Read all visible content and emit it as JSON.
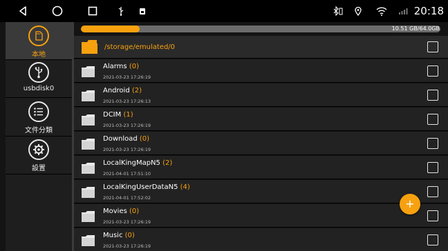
{
  "status_bar": {
    "time": "20:18",
    "icons": [
      "back-icon",
      "home-icon",
      "recents-icon",
      "usb-icon",
      "screenshot-icon",
      "bluetooth-icon",
      "location-icon",
      "wifi-icon",
      "cellular-signal-icon"
    ]
  },
  "sidebar": {
    "items": [
      {
        "label": "本地",
        "icon": "sd-card-icon",
        "active": true
      },
      {
        "label": "usbdisk0",
        "icon": "usb-icon",
        "active": false
      },
      {
        "label": "文件分類",
        "icon": "list-icon",
        "active": false
      },
      {
        "label": "設置",
        "icon": "gear-icon",
        "active": false
      }
    ]
  },
  "storage": {
    "text": "10.51 GB/64.0GB",
    "used_fraction": 0.164
  },
  "path": {
    "text": "/storage/emulated/0"
  },
  "files": [
    {
      "name": "Alarms",
      "count": "(0)",
      "date": "2021-03-23 17:26:19"
    },
    {
      "name": "Android",
      "count": "(2)",
      "date": "2021-03-23 17:26:13"
    },
    {
      "name": "DCIM",
      "count": "(1)",
      "date": "2021-03-23 17:26:19"
    },
    {
      "name": "Download",
      "count": "(0)",
      "date": "2021-03-23 17:26:19"
    },
    {
      "name": "LocalKingMapN5",
      "count": "(2)",
      "date": "2021-04-01 17:51:10"
    },
    {
      "name": "LocalKingUserDataN5",
      "count": "(4)",
      "date": "2021-04-01 17:52:02"
    },
    {
      "name": "Movies",
      "count": "(0)",
      "date": "2021-03-23 17:26:19"
    },
    {
      "name": "Music",
      "count": "(0)",
      "date": "2021-03-23 17:26:19"
    }
  ],
  "fab": {
    "symbol": "+"
  },
  "colors": {
    "accent": "#f7a10f",
    "background": "#141414",
    "sidebar": "#1e1e1e",
    "row": "#222222"
  }
}
